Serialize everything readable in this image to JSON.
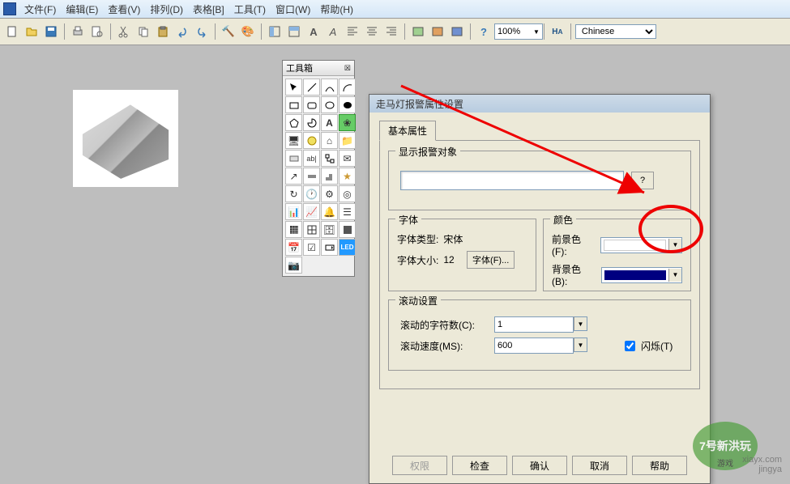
{
  "menu": {
    "items": [
      "文件(F)",
      "编辑(E)",
      "查看(V)",
      "排列(D)",
      "表格[B]",
      "工具(T)",
      "窗口(W)",
      "帮助(H)"
    ]
  },
  "toolbar": {
    "zoom": "100%",
    "lang": "Chinese"
  },
  "toolbox": {
    "title": "工具箱"
  },
  "dialog": {
    "title": "走马灯报警属性设置",
    "tab": "基本属性",
    "group_alarm": "显示报警对象",
    "alarm_value": "",
    "q": "?",
    "group_font": "字体",
    "font_type_label": "字体类型:",
    "font_type_value": "宋体",
    "font_size_label": "字体大小:",
    "font_size_value": "12",
    "font_btn": "字体(F)...",
    "group_color": "颜色",
    "fg_label": "前景色(F):",
    "bg_label": "背景色(B):",
    "group_scroll": "滚动设置",
    "scroll_chars_label": "滚动的字符数(C):",
    "scroll_chars_value": "1",
    "scroll_speed_label": "滚动速度(MS):",
    "scroll_speed_value": "600",
    "flash_label": "闪烁(T)",
    "btn_perm": "权限",
    "btn_check": "检查",
    "btn_ok": "确认",
    "btn_cancel": "取消",
    "btn_help": "帮助"
  },
  "watermark": {
    "l1": "7号新洪玩",
    "l2": "jingya",
    "l3": "游戏",
    "l4": "xiayx.com"
  }
}
